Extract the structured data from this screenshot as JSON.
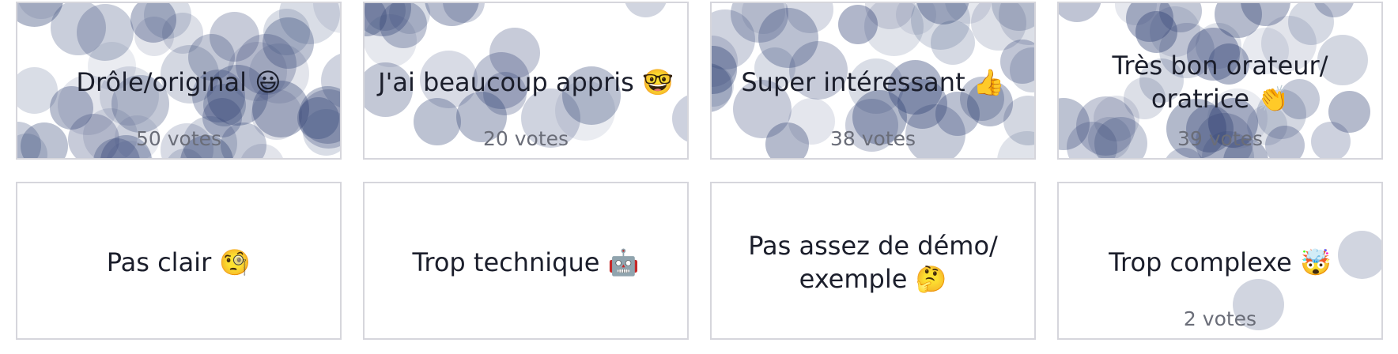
{
  "reactions": [
    {
      "label": "Drôle/original 😃",
      "votes": "50 votes",
      "count": 50
    },
    {
      "label": "J'ai beaucoup appris 🤓",
      "votes": "20 votes",
      "count": 20
    },
    {
      "label": "Super intéressant 👍",
      "votes": "38 votes",
      "count": 38
    },
    {
      "label": "Très bon orateur/ oratrice 👏",
      "votes": "39 votes",
      "count": 39
    },
    {
      "label": "Pas clair 🧐",
      "votes": "",
      "count": 0
    },
    {
      "label": "Trop technique 🤖",
      "votes": "",
      "count": 0
    },
    {
      "label": "Pas assez de démo/ exemple 🤔",
      "votes": "",
      "count": 0
    },
    {
      "label": "Trop complexe 🤯",
      "votes": "2 votes",
      "count": 2
    }
  ]
}
